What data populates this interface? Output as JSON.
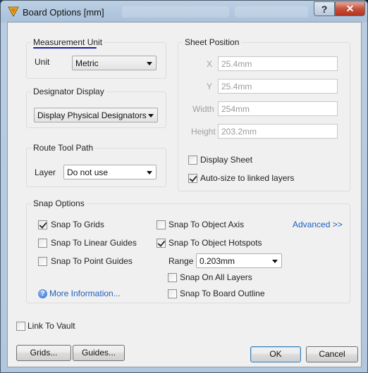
{
  "window": {
    "title": "Board Options [mm]",
    "help_glyph": "?",
    "close_glyph": "✕"
  },
  "measurement": {
    "group_title": "Measurement Unit",
    "unit_label": "Unit",
    "unit_value": "Metric"
  },
  "designator": {
    "group_title": "Designator Display",
    "value": "Display Physical Designators"
  },
  "route": {
    "group_title": "Route Tool Path",
    "layer_label": "Layer",
    "layer_value": "Do not use"
  },
  "sheet": {
    "group_title": "Sheet Position",
    "x_label": "X",
    "x_value": "25.4mm",
    "y_label": "Y",
    "y_value": "25.4mm",
    "width_label": "Width",
    "width_value": "254mm",
    "height_label": "Height",
    "height_value": "203.2mm",
    "display_sheet_label": "Display Sheet",
    "display_sheet_checked": false,
    "autosize_label": "Auto-size to linked layers",
    "autosize_checked": true
  },
  "snap": {
    "group_title": "Snap Options",
    "advanced_label": "Advanced >>",
    "grids_label": "Snap To Grids",
    "grids_checked": true,
    "linear_label": "Snap To Linear Guides",
    "linear_checked": false,
    "point_label": "Snap To Point Guides",
    "point_checked": false,
    "object_axis_label": "Snap To Object Axis",
    "object_axis_checked": false,
    "object_hotspots_label": "Snap To Object Hotspots",
    "object_hotspots_checked": true,
    "range_label": "Range",
    "range_value": "0.203mm",
    "all_layers_label": "Snap On All Layers",
    "all_layers_checked": false,
    "board_outline_label": "Snap To Board Outline",
    "board_outline_checked": false,
    "more_info_label": "More Information...",
    "info_glyph": "?"
  },
  "vault": {
    "label": "Link To Vault",
    "checked": false
  },
  "buttons": {
    "grids": "Grids...",
    "guides": "Guides...",
    "ok": "OK",
    "cancel": "Cancel"
  }
}
